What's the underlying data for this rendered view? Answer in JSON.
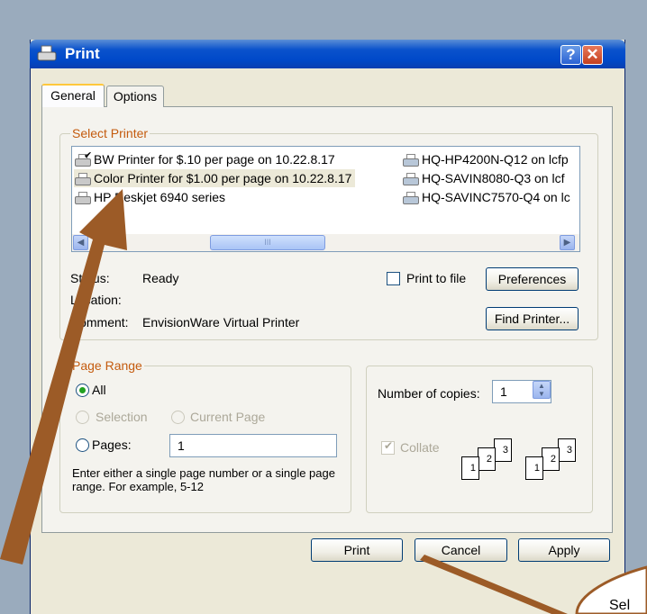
{
  "window": {
    "title": "Print",
    "help_label": "?",
    "close_label": "✕"
  },
  "tabs": [
    {
      "label": "General",
      "active": true
    },
    {
      "label": "Options",
      "active": false
    }
  ],
  "select_printer": {
    "legend": "Select Printer",
    "printers": [
      {
        "name": "BW Printer for $.10 per page on 10.22.8.17",
        "icon": "default-printer-icon",
        "default": true
      },
      {
        "name": "Color Printer for $1.00 per page on 10.22.8.17",
        "icon": "printer-icon",
        "selected": true
      },
      {
        "name": "HP Deskjet 6940 series",
        "icon": "printer-icon"
      },
      {
        "name": "HQ-HP4200N-Q12 on lcfp",
        "icon": "network-printer-icon"
      },
      {
        "name": "HQ-SAVIN8080-Q3 on lcf",
        "icon": "network-printer-icon"
      },
      {
        "name": "HQ-SAVINC7570-Q4 on lc",
        "icon": "network-printer-icon"
      }
    ],
    "scroll_thumb_grip": "III",
    "status_label": "Status:",
    "status_value": "Ready",
    "location_label": "Location:",
    "location_value": "",
    "comment_label": "Comment:",
    "comment_value": "EnvisionWare Virtual Printer",
    "print_to_file_label": "Print to file",
    "print_to_file_checked": false,
    "preferences_label": "Preferences",
    "find_printer_label": "Find Printer..."
  },
  "page_range": {
    "legend": "Page Range",
    "all_label": "All",
    "selection_label": "Selection",
    "current_page_label": "Current Page",
    "pages_label": "Pages:",
    "pages_value": "1",
    "help_text": "Enter either a single page number or a single page range.  For example, 5-12",
    "selected": "All"
  },
  "copies": {
    "label": "Number of copies:",
    "value": "1",
    "collate_label": "Collate",
    "collate_checked": true,
    "collate_icon_pages": [
      "1",
      "2",
      "3"
    ]
  },
  "buttons": {
    "print": "Print",
    "cancel": "Cancel",
    "apply": "Apply"
  },
  "callout": {
    "text": "Sel"
  },
  "colors": {
    "desktop": "#9aabbd",
    "titlebar": "#0a52cc",
    "dialog": "#ece9d8",
    "arrow": "#9c5b27",
    "group_legend": "#c45b0e"
  }
}
